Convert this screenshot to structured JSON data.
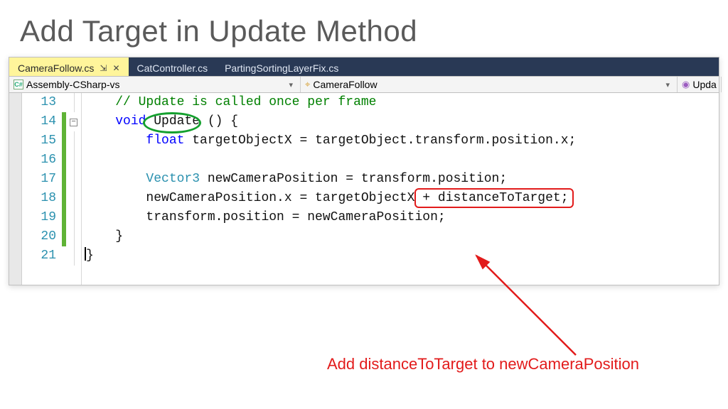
{
  "slide": {
    "title": "Add Target in Update Method"
  },
  "tabs": [
    {
      "label": "CameraFollow.cs",
      "active": true
    },
    {
      "label": "CatController.cs",
      "active": false
    },
    {
      "label": "PartingSortingLayerFix.cs",
      "active": false
    }
  ],
  "crumbs": {
    "project": "Assembly-CSharp-vs",
    "class": "CameraFollow",
    "method": "Upda"
  },
  "line_numbers": [
    "13",
    "14",
    "15",
    "16",
    "17",
    "18",
    "19",
    "20",
    "21",
    ""
  ],
  "changed_lines": [
    1,
    2,
    3,
    4,
    5,
    6,
    7
  ],
  "code": {
    "l13_comment": "// Update is called once per frame",
    "l14_kw": "void",
    "l14_name": " Update () {",
    "l15_kw": "float",
    "l15_rest": " targetObjectX = targetObject.transform.position.x;",
    "l17_type": "Vector3",
    "l17_rest": " newCameraPosition = transform.position;",
    "l18": "newCameraPosition.x = targetObjectX + distanceToTarget;",
    "l19": "transform.position = newCameraPosition;",
    "l20": "    }",
    "l21": "}"
  },
  "callout": "Add distanceToTarget to newCameraPosition",
  "colors": {
    "tab_active_bg": "#fff59b",
    "tab_inactive_bg": "#293955",
    "red": "#e21b1b",
    "green": "#14a02e"
  }
}
